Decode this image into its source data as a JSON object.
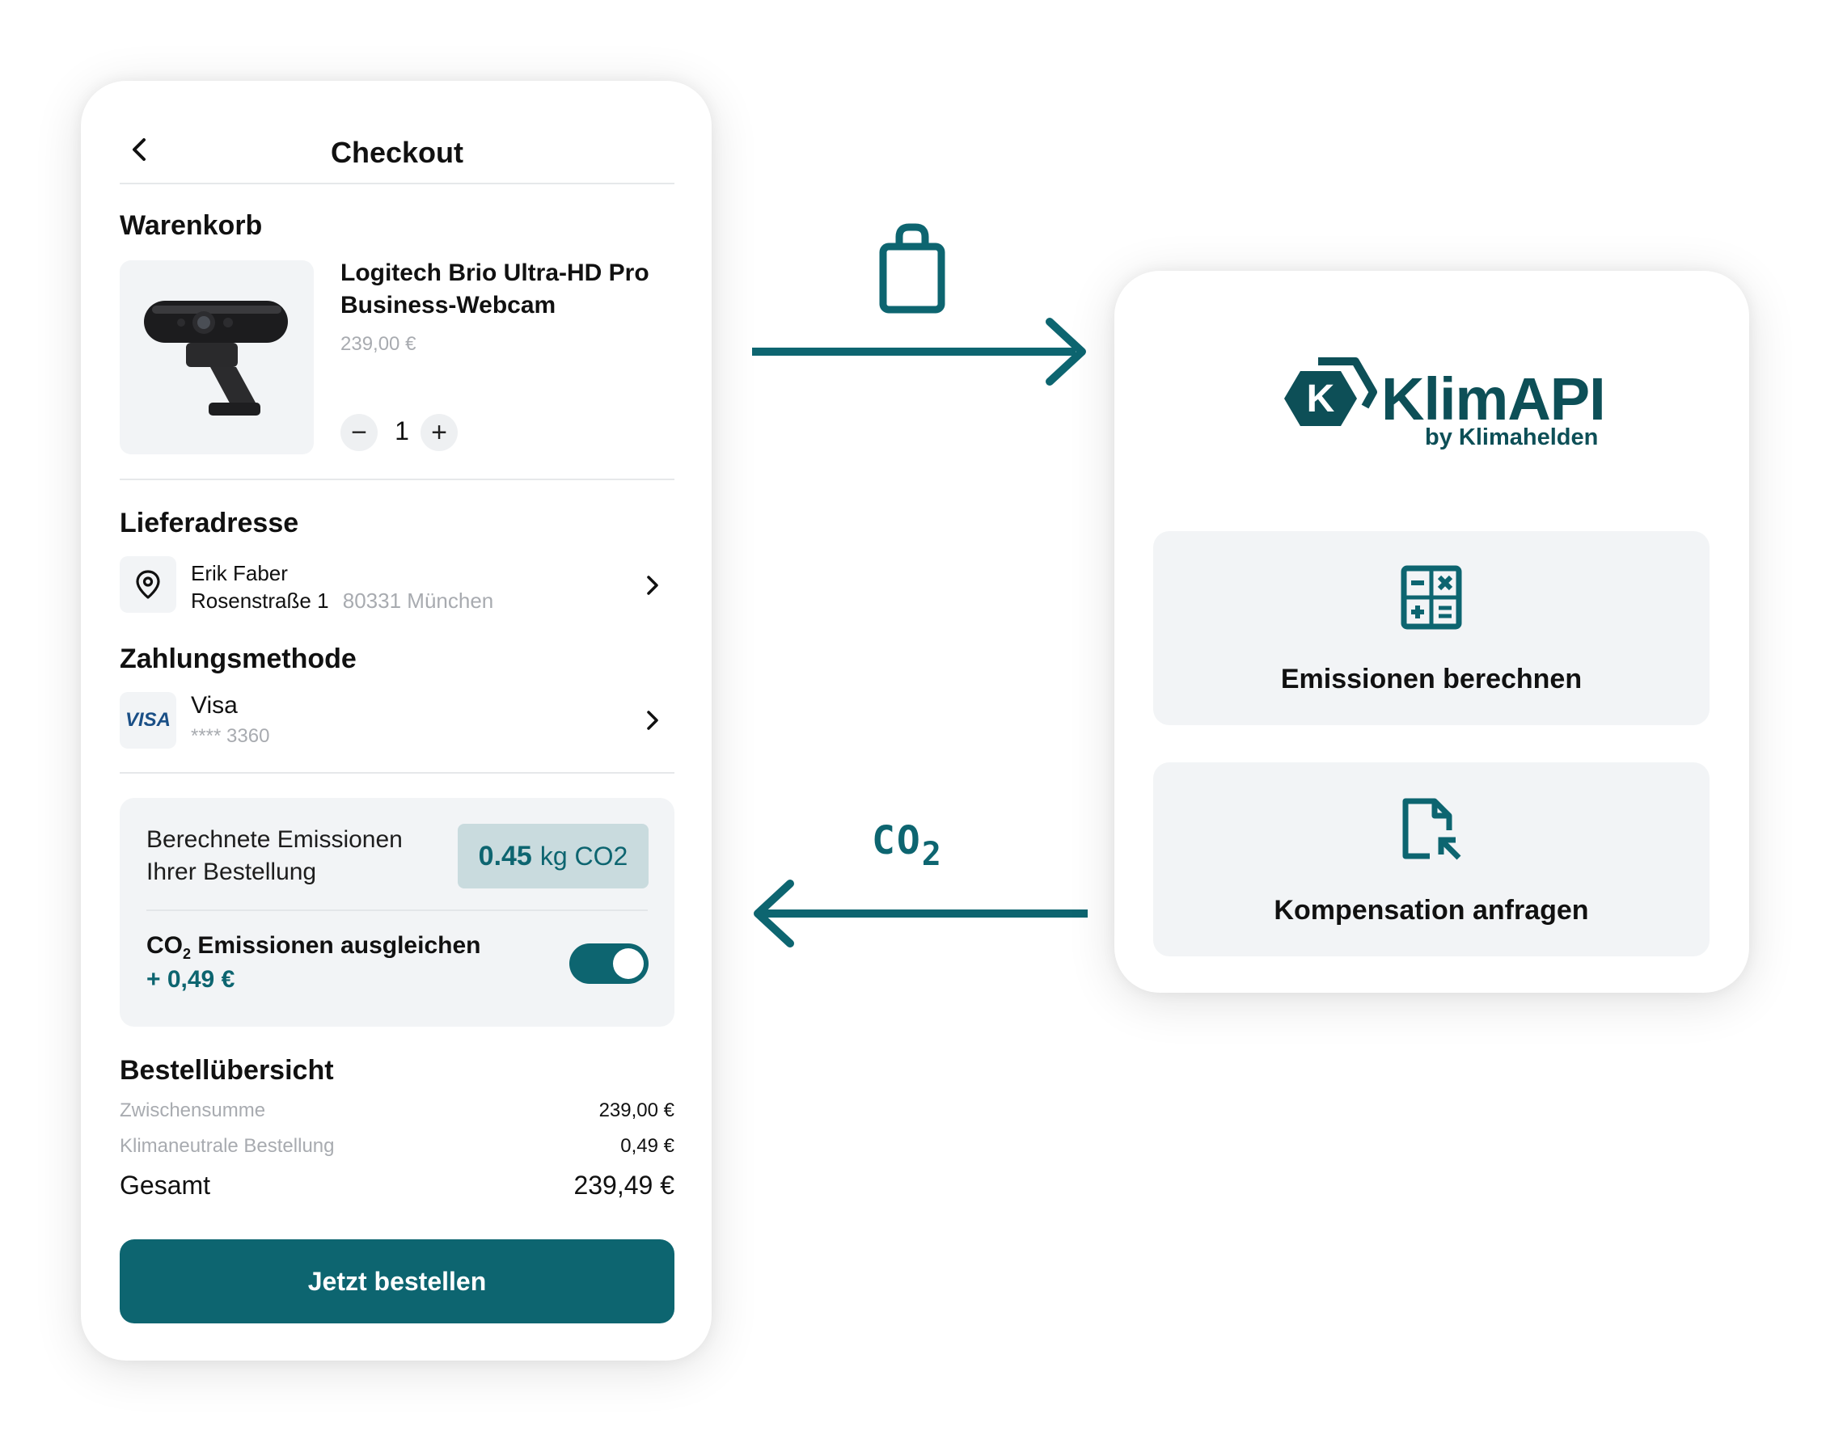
{
  "colors": {
    "accent": "#0d6570",
    "panel": "#f2f4f6",
    "badge": "#c9dbde"
  },
  "checkout": {
    "title": "Checkout",
    "cart": {
      "heading": "Warenkorb",
      "product_name": "Logitech Brio Ultra-HD Pro Business-Webcam",
      "product_price": "239,00 €",
      "quantity": "1",
      "minus": "−",
      "plus": "+"
    },
    "address": {
      "heading": "Lieferadresse",
      "name": "Erik Faber",
      "street": "Rosenstraße 1",
      "city": "80331 München"
    },
    "payment": {
      "heading": "Zahlungsmethode",
      "card_logo": "VISA",
      "method": "Visa",
      "masked": "**** 3360"
    },
    "emissions": {
      "label_line1": "Berechnete Emissionen",
      "label_line2": "Ihrer Bestellung",
      "value": "0.45",
      "unit": "kg CO2",
      "offset_prefix": "CO",
      "offset_sub": "2",
      "offset_suffix": " Emissionen ausgleichen",
      "offset_price": "+ 0,49 €",
      "toggle_on": true
    },
    "summary": {
      "heading": "Bestellübersicht",
      "rows": [
        {
          "label": "Zwischensumme",
          "value": "239,00 €"
        },
        {
          "label": "Klimaneutrale Bestellung",
          "value": "0,49 €"
        }
      ],
      "total_label": "Gesamt",
      "total_value": "239,49 €"
    },
    "cta": "Jetzt bestellen"
  },
  "flow": {
    "to_api_icon": "shopping-bag-icon",
    "from_api_label_main": "CO",
    "from_api_label_sub": "2"
  },
  "api": {
    "logo_letter": "K",
    "brand": "KlimAPI",
    "brand_sub": "by Klimahelden",
    "features": [
      {
        "label": "Emissionen berechnen",
        "icon": "calculator-icon"
      },
      {
        "label": "Kompensation anfragen",
        "icon": "document-request-icon"
      }
    ]
  }
}
